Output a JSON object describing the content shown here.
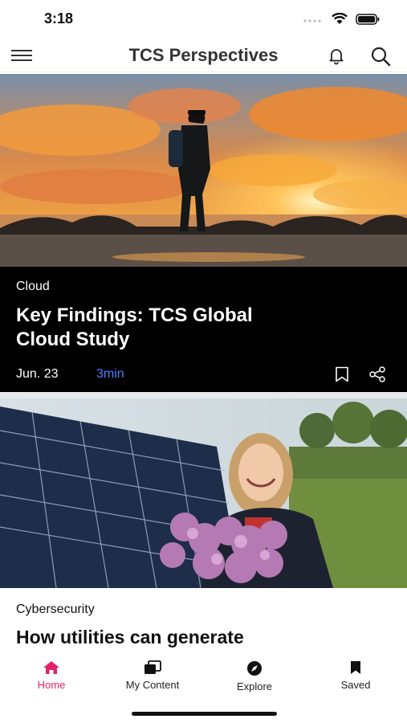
{
  "status": {
    "time": "3:18"
  },
  "header": {
    "title": "TCS Perspectives",
    "menu_icon": "hamburger-icon",
    "notification_icon": "bell-icon",
    "search_icon": "search-icon"
  },
  "feed": {
    "articles": [
      {
        "category": "Cloud",
        "title": "Key Findings: TCS Global Cloud Study",
        "date": "Jun. 23",
        "read_time": "3min",
        "image": "hiker-sunset-image"
      },
      {
        "category": "Cybersecurity",
        "title": "How utilities can generate",
        "image": "girl-solar-panels-image"
      }
    ]
  },
  "tabs": [
    {
      "label": "Home",
      "icon": "home-icon",
      "active": true
    },
    {
      "label": "My Content",
      "icon": "my-content-icon",
      "active": false
    },
    {
      "label": "Explore",
      "icon": "compass-icon",
      "active": false
    },
    {
      "label": "Saved",
      "icon": "bookmark-icon",
      "active": false
    }
  ],
  "colors": {
    "accent": "#e0236b",
    "read_time": "#4a7fff",
    "card_dark": "#000000"
  }
}
